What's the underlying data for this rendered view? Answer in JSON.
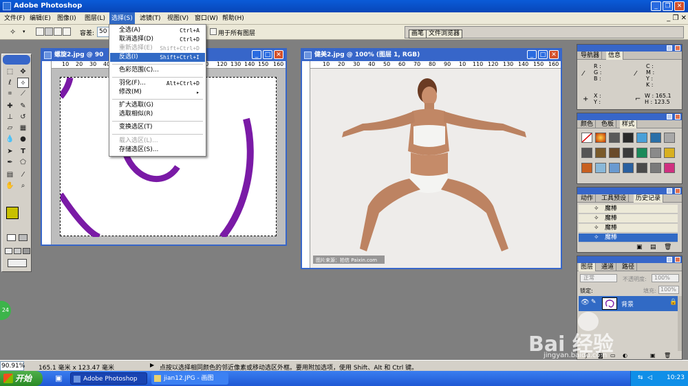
{
  "app": {
    "title": "Adobe Photoshop"
  },
  "menubar": [
    "文件(F)",
    "编辑(E)",
    "图像(I)",
    "图层(L)",
    "选择(S)",
    "滤镜(T)",
    "视图(V)",
    "窗口(W)",
    "帮助(H)"
  ],
  "options": {
    "tolerance_label": "容差:",
    "tolerance_value": "50",
    "all_layers_label": "用于所有图层"
  },
  "palette_well": {
    "tab1": "画笔",
    "tab2": "文件浏览器"
  },
  "select_menu": [
    {
      "label": "全选(A)",
      "shortcut": "Ctrl+A",
      "disabled": false
    },
    {
      "label": "取消选择(D)",
      "shortcut": "Ctrl+D",
      "disabled": false
    },
    {
      "label": "重新选择(E)",
      "shortcut": "Shift+Ctrl+D",
      "disabled": true
    },
    {
      "label": "反选(I)",
      "shortcut": "Shift+Ctrl+I",
      "disabled": false,
      "highlight": true
    },
    {
      "label": "色彩范围(C)...",
      "shortcut": "",
      "disabled": false
    },
    {
      "label": "羽化(F)...",
      "shortcut": "Alt+Ctrl+D",
      "disabled": false
    },
    {
      "label": "修改(M)",
      "shortcut": "▸",
      "disabled": false
    },
    {
      "label": "扩大选取(G)",
      "shortcut": "",
      "disabled": false
    },
    {
      "label": "选取相似(R)",
      "shortcut": "",
      "disabled": false
    },
    {
      "label": "变换选区(T)",
      "shortcut": "",
      "disabled": false
    },
    {
      "label": "载入选区(L)...",
      "shortcut": "",
      "disabled": true
    },
    {
      "label": "存储选区(S)...",
      "shortcut": "",
      "disabled": false
    }
  ],
  "doc1": {
    "title": "螺旋2.jpg @ 90"
  },
  "doc2": {
    "title": "健美2.jpg @ 100% (图层 1, RGB)",
    "watermark": "图片来源：拍信 Paixin.com"
  },
  "ruler_labels": [
    "10",
    "20",
    "30",
    "40",
    "50",
    "60",
    "70",
    "80",
    "90",
    "100",
    "110",
    "120",
    "130",
    "140",
    "150",
    "160"
  ],
  "ruler_labels_short": [
    "10",
    "20",
    "30",
    "40",
    "50",
    "60",
    "70",
    "80",
    "90",
    "10",
    "110",
    "120",
    "130",
    "140",
    "150",
    "160"
  ],
  "navigator": {
    "tabs": [
      "导航器",
      "信息"
    ],
    "rgb": [
      "R :",
      "G :",
      "B :"
    ],
    "cmyk": [
      "C :",
      "M :",
      "Y :",
      "K :"
    ],
    "xy": [
      "X :",
      "Y :"
    ],
    "w_label": "W :",
    "w_value": "165.1",
    "h_label": "H :",
    "h_value": "123.5"
  },
  "swatches_panel": {
    "tabs": [
      "颜色",
      "色板",
      "样式"
    ]
  },
  "history_panel": {
    "tabs": [
      "动作",
      "工具预设",
      "历史记录"
    ],
    "items": [
      "魔棒",
      "魔棒",
      "魔棒",
      "魔棒"
    ]
  },
  "layers_panel": {
    "tabs": [
      "图层",
      "通道",
      "路径"
    ],
    "blend_mode": "正常",
    "opacity_label": "不透明度:",
    "opacity": "100%",
    "lock_label": "锁定:",
    "fill_label": "填充:",
    "fill": "100%",
    "layer_name": "背景"
  },
  "status": {
    "zoom": "90.91%",
    "doc_size": "165.1 毫米 x 123.47 毫米",
    "hint": "点按以选择相同颜色的邻近像素或移动选区外框。要用附加选项，使用 Shift、Alt 和 Ctrl 键。"
  },
  "taskbar": {
    "start": "开始",
    "task1": "Adobe Photoshop",
    "task2": "jian12.JPG - 画图",
    "clock": "10:23"
  },
  "overlay": {
    "baidu_text": "Bai  经验",
    "baidu_url": "jingyan.baidu.com",
    "badge": "24"
  },
  "colors": {
    "foreground": "#c8c000",
    "background": "#1010c0",
    "spiral": "#7a1aa6",
    "highlight": "#316ac5"
  }
}
